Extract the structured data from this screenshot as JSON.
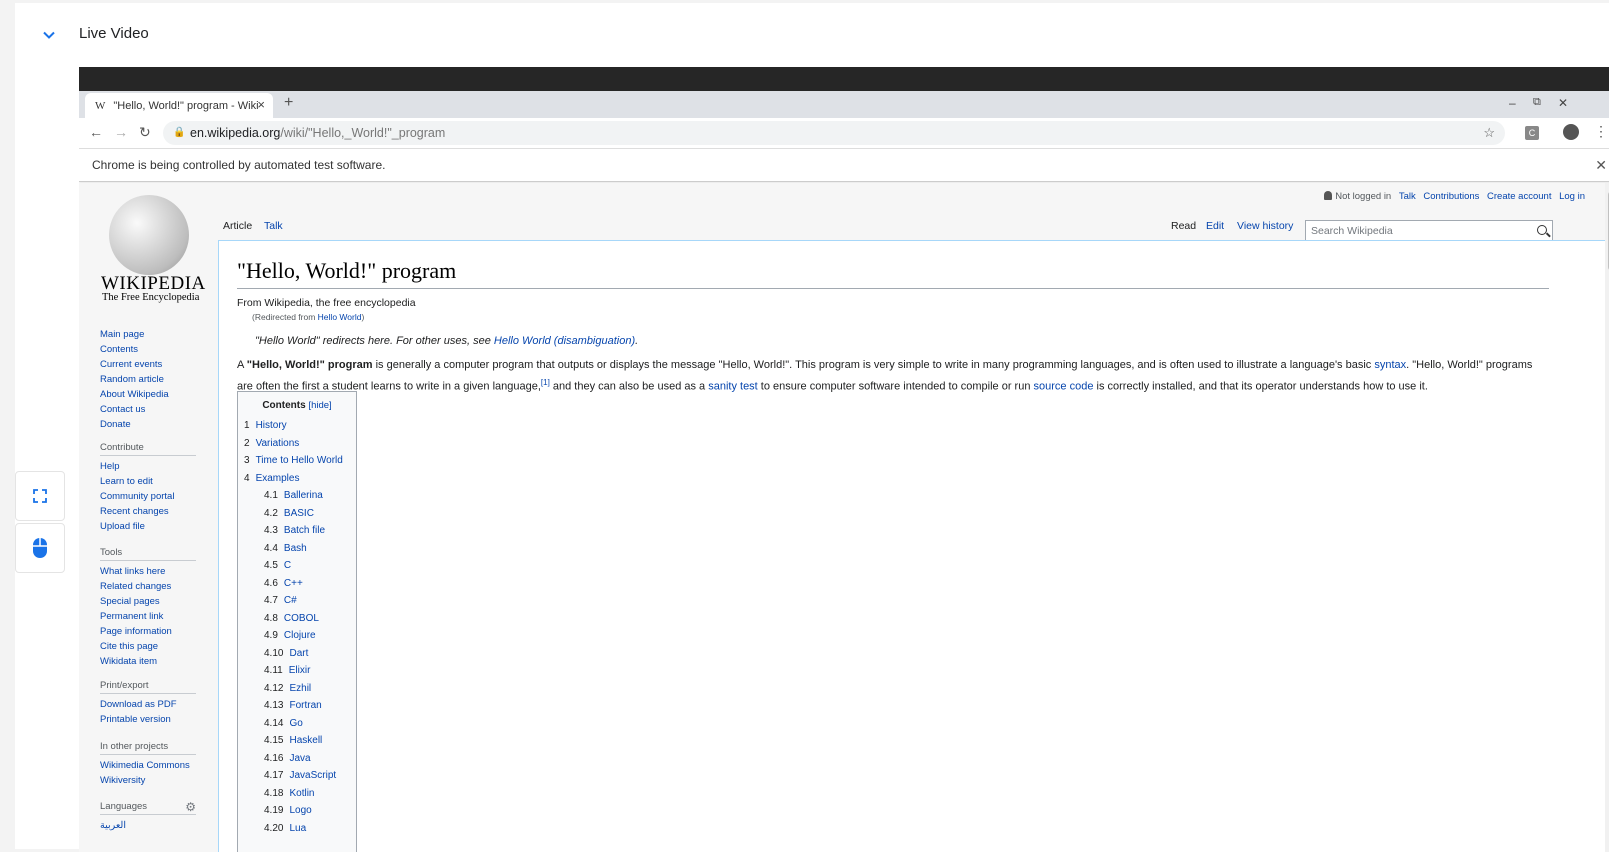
{
  "live_video": {
    "title": "Live Video"
  },
  "browser": {
    "tab_title": "\"Hello, World!\" program - Wikipedia",
    "tab_favicon": "W",
    "url_host": "en.wikipedia.org",
    "url_path": "/wiki/\"Hello,_World!\"_program",
    "infobar_text": "Chrome is being controlled by automated test software.",
    "extension_label": "C"
  },
  "wiki": {
    "logo_word": "WIKIPEDIA",
    "logo_tagline": "The Free Encyclopedia",
    "user_links": {
      "not_logged_in": "Not logged in",
      "talk": "Talk",
      "contributions": "Contributions",
      "create_account": "Create account",
      "log_in": "Log in"
    },
    "tabs_left": [
      "Article",
      "Talk"
    ],
    "tabs_right": [
      "Read",
      "Edit",
      "View history"
    ],
    "search_placeholder": "Search Wikipedia",
    "nav_main": [
      "Main page",
      "Contents",
      "Current events",
      "Random article",
      "About Wikipedia",
      "Contact us",
      "Donate"
    ],
    "contribute_heading": "Contribute",
    "nav_contribute": [
      "Help",
      "Learn to edit",
      "Community portal",
      "Recent changes",
      "Upload file"
    ],
    "tools_heading": "Tools",
    "nav_tools": [
      "What links here",
      "Related changes",
      "Special pages",
      "Permanent link",
      "Page information",
      "Cite this page",
      "Wikidata item"
    ],
    "print_heading": "Print/export",
    "nav_print": [
      "Download as PDF",
      "Printable version"
    ],
    "projects_heading": "In other projects",
    "nav_projects": [
      "Wikimedia Commons",
      "Wikiversity"
    ],
    "languages_heading": "Languages",
    "nav_languages": [
      "العربية"
    ],
    "article": {
      "title": "\"Hello, World!\" program",
      "site_sub": "From Wikipedia, the free encyclopedia",
      "redirected_prefix": "(Redirected from ",
      "redirected_link": "Hello World",
      "redirected_suffix": ")",
      "hatnote_text": "\"Hello World\" redirects here. For other uses, see ",
      "hatnote_link": "Hello World (disambiguation)",
      "hatnote_end": ".",
      "p1_a": "A ",
      "p1_bold": "\"Hello, World!\" program",
      "p1_b": " is generally a computer program that outputs or displays the message \"Hello, World!\". This program is very simple to write in many programming languages, and is often used to illustrate a language's basic ",
      "p1_link_syntax": "syntax",
      "p1_c": ". \"Hello, World!\" programs are often the first a student learns to write in a given language,",
      "p1_ref": "[1]",
      "p1_d": " and they can also be used as a ",
      "p1_link_sanity": "sanity test",
      "p1_e": " to ensure computer software intended to compile or run ",
      "p1_link_source": "source code",
      "p1_f": " is correctly installed, and that its operator understands how to use it."
    },
    "toc": {
      "title": "Contents",
      "hide": "[hide]",
      "items": [
        {
          "num": "1",
          "label": "History"
        },
        {
          "num": "2",
          "label": "Variations"
        },
        {
          "num": "3",
          "label": "Time to Hello World"
        },
        {
          "num": "4",
          "label": "Examples"
        }
      ],
      "sub_items": [
        {
          "num": "4.1",
          "label": "Ballerina"
        },
        {
          "num": "4.2",
          "label": "BASIC"
        },
        {
          "num": "4.3",
          "label": "Batch file"
        },
        {
          "num": "4.4",
          "label": "Bash"
        },
        {
          "num": "4.5",
          "label": "C"
        },
        {
          "num": "4.6",
          "label": "C++"
        },
        {
          "num": "4.7",
          "label": "C#"
        },
        {
          "num": "4.8",
          "label": "COBOL"
        },
        {
          "num": "4.9",
          "label": "Clojure"
        },
        {
          "num": "4.10",
          "label": "Dart"
        },
        {
          "num": "4.11",
          "label": "Elixir"
        },
        {
          "num": "4.12",
          "label": "Ezhil"
        },
        {
          "num": "4.13",
          "label": "Fortran"
        },
        {
          "num": "4.14",
          "label": "Go"
        },
        {
          "num": "4.15",
          "label": "Haskell"
        },
        {
          "num": "4.16",
          "label": "Java"
        },
        {
          "num": "4.17",
          "label": "JavaScript"
        },
        {
          "num": "4.18",
          "label": "Kotlin"
        },
        {
          "num": "4.19",
          "label": "Logo"
        },
        {
          "num": "4.20",
          "label": "Lua"
        }
      ]
    }
  },
  "colors": {
    "link": "#0645ad",
    "accent": "#1a73e8",
    "os_bar": "#262626"
  }
}
